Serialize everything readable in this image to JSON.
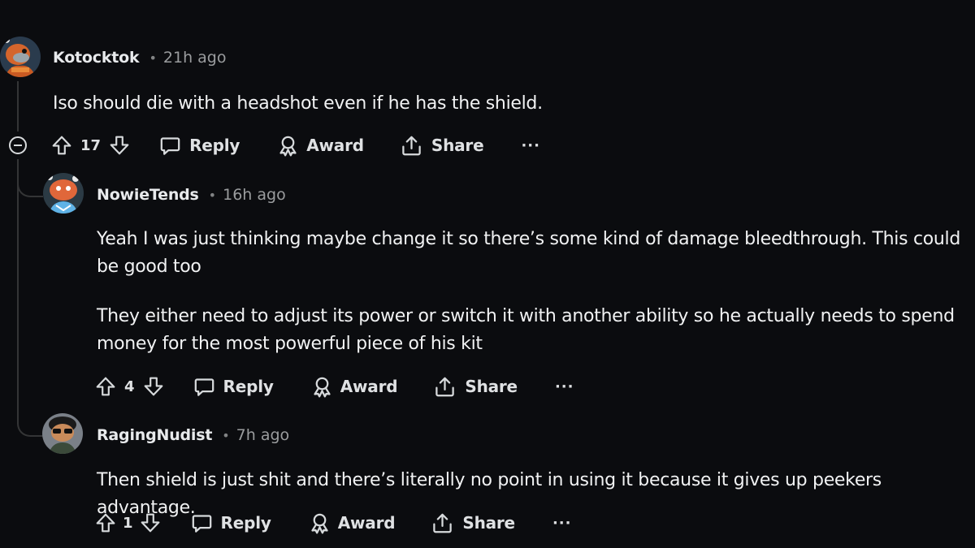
{
  "colors": {
    "background": "#0b0c0f",
    "thread_line": "#343536",
    "text": "#f1f2f3",
    "muted": "#9a9c9e"
  },
  "comments": [
    {
      "username": "Kotocktok",
      "separator": "•",
      "time": "21h ago",
      "body": [
        "Iso should die with a headshot even if he has the shield."
      ],
      "votes": "17",
      "reply_label": "Reply",
      "award_label": "Award",
      "share_label": "Share",
      "more_label": "···"
    },
    {
      "username": "NowieTends",
      "separator": "•",
      "time": "16h ago",
      "body": [
        "Yeah I was just thinking maybe change it so there’s some kind of damage bleedthrough. This could be good too",
        "They either need to adjust its power or switch it with another ability so he actually needs to spend money for the most powerful piece of his kit"
      ],
      "votes": "4",
      "reply_label": "Reply",
      "award_label": "Award",
      "share_label": "Share",
      "more_label": "···"
    },
    {
      "username": "RagingNudist",
      "separator": "•",
      "time": "7h ago",
      "body": [
        "Then shield is just shit and there’s literally no point in using it because it gives up peekers advantage."
      ],
      "votes": "1",
      "reply_label": "Reply",
      "award_label": "Award",
      "share_label": "Share",
      "more_label": "···"
    }
  ],
  "icons": {
    "upvote": "upvote-arrow-icon",
    "downvote": "downvote-arrow-icon",
    "reply": "speech-bubble-icon",
    "award": "award-ribbon-icon",
    "share": "share-upload-icon",
    "more": "ellipsis-icon",
    "collapse": "collapse-minus-icon"
  }
}
